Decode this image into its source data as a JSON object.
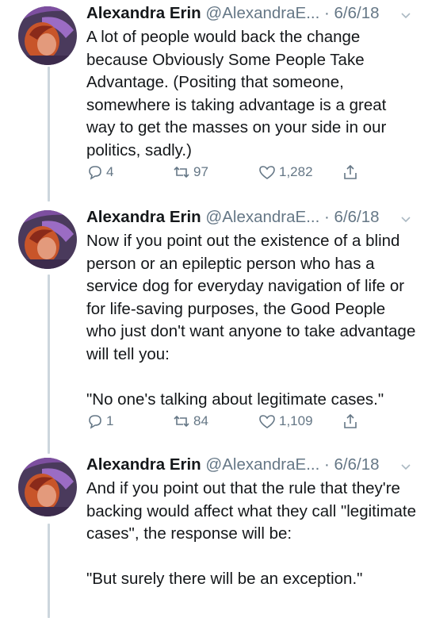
{
  "tweets": [
    {
      "name": "Alexandra Erin",
      "handle": "@AlexandraE...",
      "dot": "·",
      "date": "6/6/18",
      "paragraphs": [
        "A lot of people would back the change because Obviously Some People Take Advantage. (Positing that someone, somewhere is taking advantage is a great way to get the masses on your side in our politics, sadly.)"
      ],
      "replies": "4",
      "retweets": "97",
      "likes": "1,282"
    },
    {
      "name": "Alexandra Erin",
      "handle": "@AlexandraE...",
      "dot": "·",
      "date": "6/6/18",
      "paragraphs": [
        "Now if you point out the existence of a blind person or an epileptic person who has a service dog for everyday navigation of life or for life-saving purposes, the Good People who just don't want anyone to take advantage will tell you:",
        "\"No one's talking about legitimate cases.\""
      ],
      "replies": "1",
      "retweets": "84",
      "likes": "1,109"
    },
    {
      "name": "Alexandra Erin",
      "handle": "@AlexandraE...",
      "dot": "·",
      "date": "6/6/18",
      "paragraphs": [
        "And if you point out that the rule that they're backing would affect what they call \"legitimate cases\", the response will be:",
        "\"But surely there will be an exception.\""
      ]
    }
  ],
  "icons": {
    "reply": "reply-icon",
    "retweet": "retweet-icon",
    "like": "heart-icon",
    "share": "share-icon",
    "caret": "chevron-down-icon"
  },
  "colors": {
    "text": "#14171a",
    "secondary": "#657786",
    "thread_line": "#ccd6dd"
  }
}
